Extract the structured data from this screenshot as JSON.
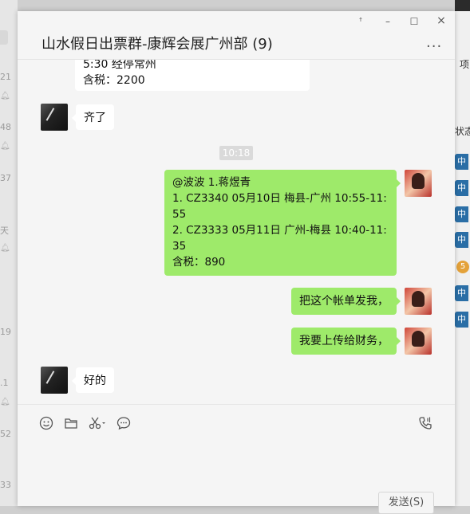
{
  "background_left": {
    "fragments": [
      "21",
      "48",
      "37",
      "天",
      "19",
      ".1",
      "52",
      "33"
    ]
  },
  "background_right": {
    "fragments": [
      "项",
      "状态"
    ],
    "badges": [
      "中",
      "中",
      "中",
      "中",
      "中",
      "中"
    ],
    "orange_badge": "5"
  },
  "window": {
    "title": "山水假日出票群-康辉会展广州部 (9)",
    "controls": {
      "pin": "ꜛ",
      "minimize": "–",
      "maximize": "☐",
      "close": "×"
    },
    "more": "···"
  },
  "messages": [
    {
      "side": "left",
      "partial": true,
      "lines": [
        "5:30 经停常州",
        "含税：2200"
      ]
    },
    {
      "side": "left",
      "lines": [
        "齐了"
      ]
    },
    {
      "type": "time",
      "text": "10:18"
    },
    {
      "side": "right",
      "lines": [
        "@波波 1.蒋煜青",
        "1.  CZ3340  05月10日  梅县-广州 10:55-11:",
        "55",
        "2.  CZ3333  05月11日  广州-梅县 10:40-11:",
        "35",
        "含税：890"
      ]
    },
    {
      "side": "right",
      "lines": [
        "把这个帐单发我，"
      ]
    },
    {
      "side": "right",
      "lines": [
        "我要上传给财务，"
      ]
    },
    {
      "side": "left",
      "lines": [
        "好的"
      ]
    }
  ],
  "toolbar": {
    "icons": [
      "emoji-icon",
      "folder-icon",
      "scissors-icon",
      "chat-history-icon",
      "voice-call-icon"
    ]
  },
  "send_button": "发送(S)"
}
